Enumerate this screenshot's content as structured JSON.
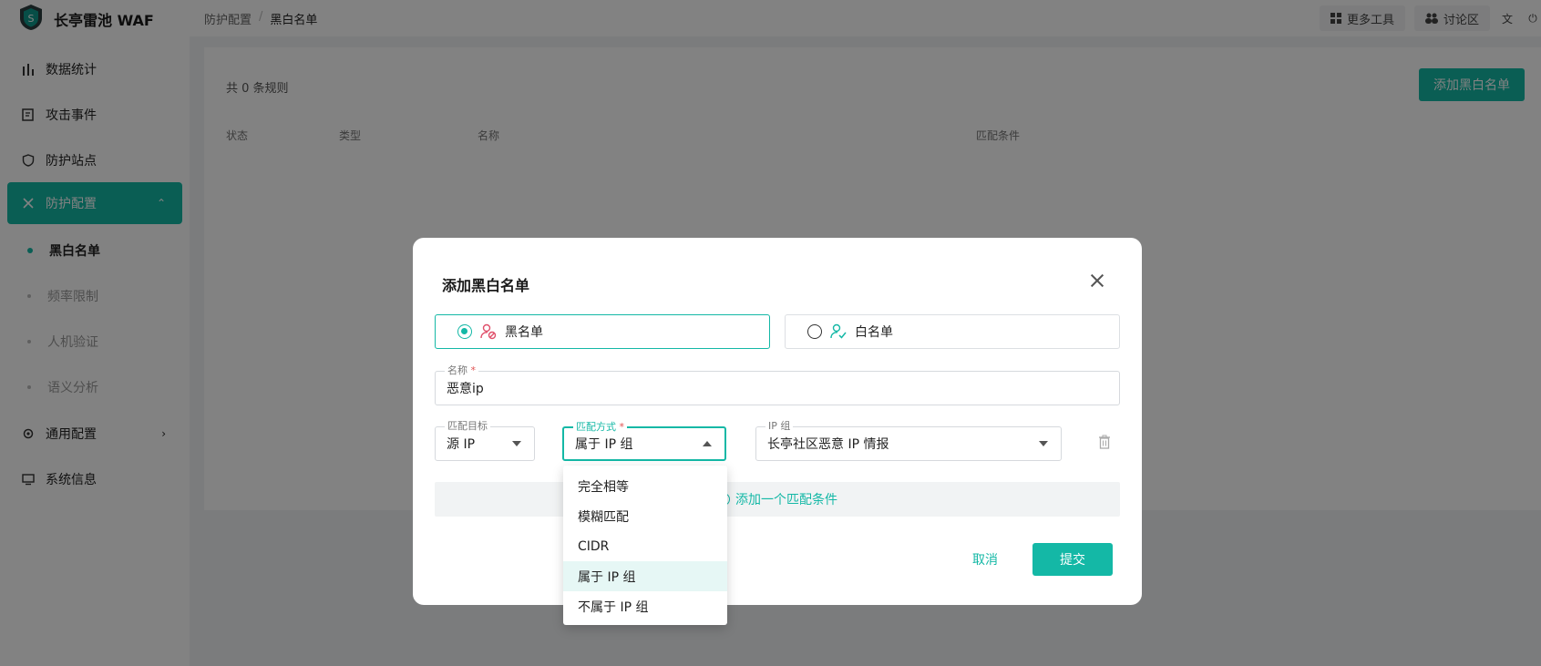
{
  "app": {
    "brand": "长亭雷池 WAF",
    "breadcrumb": [
      "防护配置",
      "黑白名单"
    ],
    "top_actions": {
      "more_tools": "更多工具",
      "forum": "讨论区"
    },
    "accent": "#14b8a6"
  },
  "sidebar": {
    "items": [
      {
        "label": "数据统计",
        "icon": "bar-chart-icon"
      },
      {
        "label": "攻击事件",
        "icon": "event-doc-icon"
      },
      {
        "label": "防护站点",
        "icon": "shield-icon"
      },
      {
        "label": "防护配置",
        "icon": "tools-icon",
        "active": true
      },
      {
        "label": "通用配置",
        "icon": "gear-icon"
      },
      {
        "label": "系统信息",
        "icon": "monitor-icon"
      }
    ],
    "sub_items": [
      "黑白名单",
      "频率限制",
      "人机验证",
      "语义分析"
    ]
  },
  "main": {
    "rule_count": "共 0 条规则",
    "add_button": "添加黑白名单",
    "columns": [
      "状态",
      "类型",
      "名称",
      "匹配条件"
    ]
  },
  "modal": {
    "title": "添加黑白名单",
    "list_types": [
      "黑名单",
      "白名单"
    ],
    "name_label": "名称",
    "name_value": "恶意ip",
    "target_label": "匹配目标",
    "target_value": "源 IP",
    "method_label": "匹配方式",
    "method_value": "属于 IP 组",
    "ipgroup_label": "IP 组",
    "ipgroup_value": "长亭社区恶意 IP 情报",
    "add_condition": "添加一个匹配条件",
    "cancel": "取消",
    "submit": "提交"
  },
  "dropdown": {
    "options": [
      "完全相等",
      "模糊匹配",
      "CIDR",
      "属于 IP 组",
      "不属于 IP 组"
    ],
    "selected": "属于 IP 组"
  }
}
